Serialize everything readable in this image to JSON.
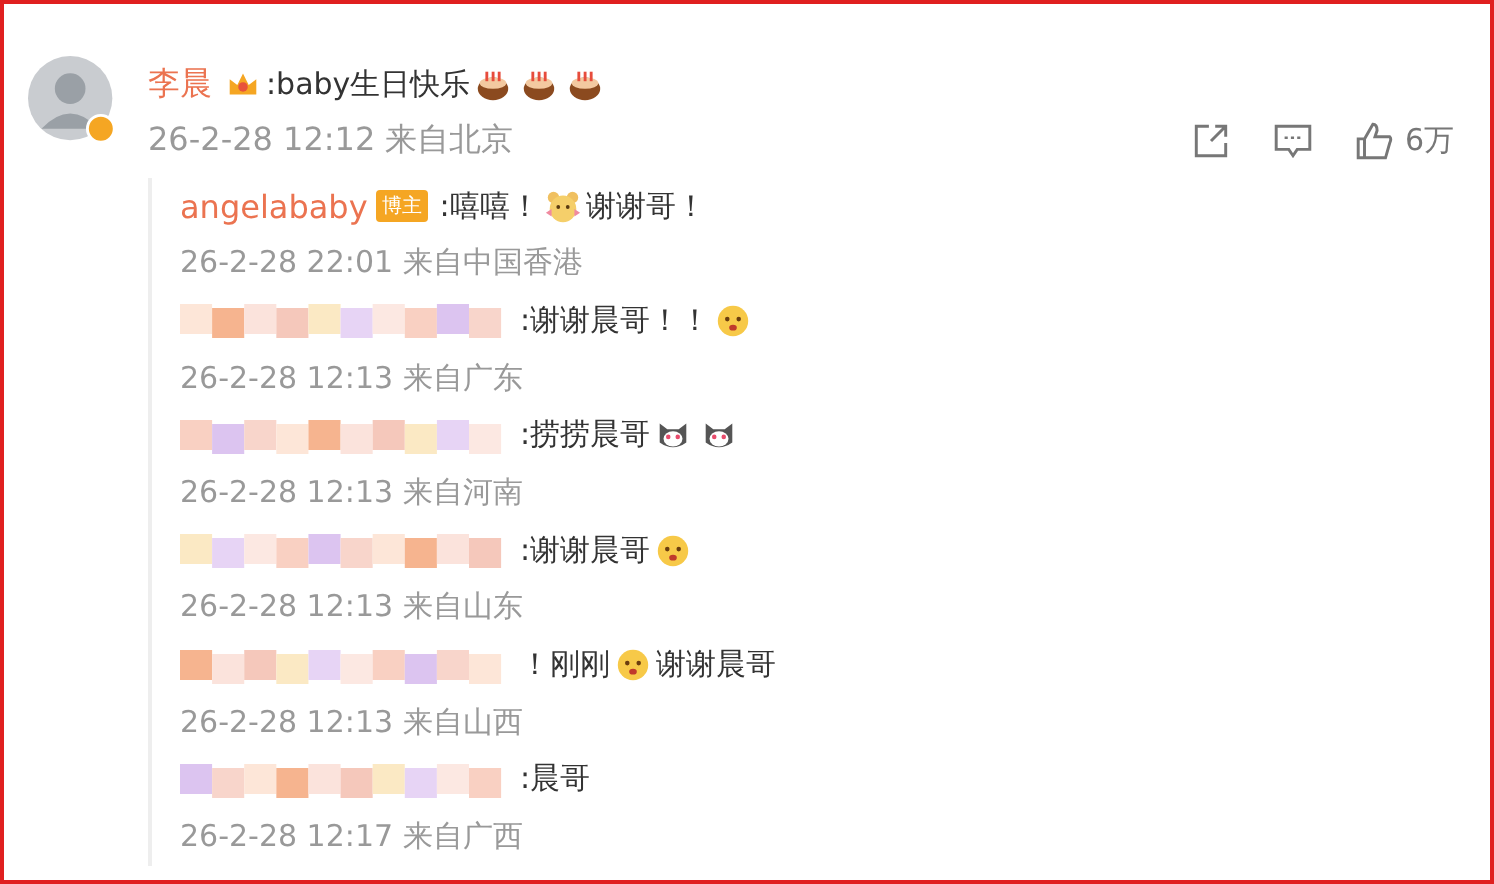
{
  "comment": {
    "user": "李晨",
    "parts": [
      {
        "kind": "text",
        "text": ":baby生日快乐"
      },
      {
        "kind": "cake"
      },
      {
        "kind": "cake"
      },
      {
        "kind": "cake"
      }
    ],
    "time": "26-2-28 12:12 来自北京",
    "likes": "6万"
  },
  "replies": [
    {
      "kind": "author",
      "user": "angelababy",
      "badge": "博主",
      "parts": [
        {
          "kind": "text",
          "text": ":嘻嘻！"
        },
        {
          "kind": "bear"
        },
        {
          "kind": "text",
          "text": "谢谢哥！"
        }
      ],
      "time": "26-2-28 22:01 来自中国香港"
    },
    {
      "kind": "hidden",
      "parts": [
        {
          "kind": "text",
          "text": ":谢谢晨哥！！"
        },
        {
          "kind": "face"
        }
      ],
      "time": "26-2-28 12:13 来自广东"
    },
    {
      "kind": "hidden",
      "parts": [
        {
          "kind": "text",
          "text": ":捞捞晨哥"
        },
        {
          "kind": "cat"
        },
        {
          "kind": "cat"
        }
      ],
      "time": "26-2-28 12:13 来自河南"
    },
    {
      "kind": "hidden",
      "parts": [
        {
          "kind": "text",
          "text": ":谢谢晨哥"
        },
        {
          "kind": "face"
        }
      ],
      "time": "26-2-28 12:13 来自山东"
    },
    {
      "kind": "hidden",
      "parts": [
        {
          "kind": "text",
          "text": "！刚刚"
        },
        {
          "kind": "face"
        },
        {
          "kind": "text",
          "text": "谢谢晨哥"
        }
      ],
      "time": "26-2-28 12:13 来自山西"
    },
    {
      "kind": "hidden",
      "parts": [
        {
          "kind": "text",
          "text": ":晨哥"
        }
      ],
      "time": "26-2-28 12:17 来自广西"
    }
  ]
}
